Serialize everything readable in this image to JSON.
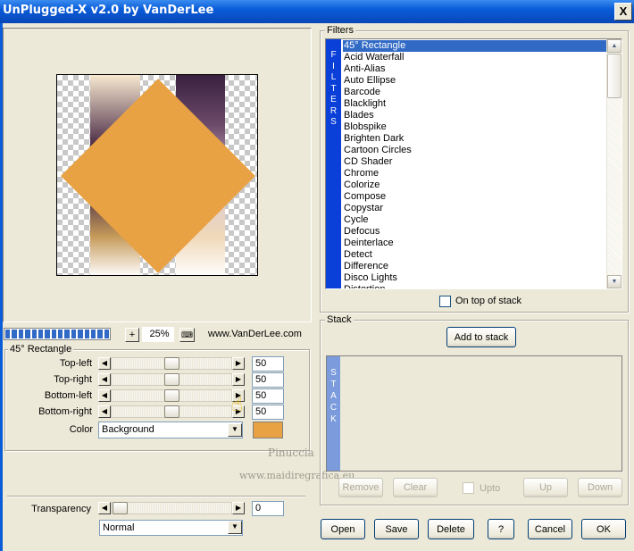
{
  "window": {
    "title": "UnPlugged-X v2.0 by VanDerLee",
    "close_label": "X"
  },
  "preview": {
    "zoom_out_label": "+",
    "zoom": "25%",
    "url": "www.VanDerLee.com",
    "progress_segments": 16
  },
  "params": {
    "group_title": "45° Rectangle",
    "sliders": [
      {
        "label": "Top-left",
        "value": "50"
      },
      {
        "label": "Top-right",
        "value": "50"
      },
      {
        "label": "Bottom-left",
        "value": "50"
      },
      {
        "label": "Bottom-right",
        "value": "50"
      }
    ],
    "color_label": "Color",
    "color_value": "Background",
    "color_swatch": "#e8a244"
  },
  "transparency": {
    "label": "Transparency",
    "value": "0",
    "blend_mode": "Normal"
  },
  "filters": {
    "group_title": "Filters",
    "side_label": [
      "F",
      "I",
      "L",
      "T",
      "E",
      "R",
      "S"
    ],
    "items": [
      "45° Rectangle",
      "Acid Waterfall",
      "Anti-Alias",
      "Auto Ellipse",
      "Barcode",
      "Blacklight",
      "Blades",
      "Blobspike",
      "Brighten Dark",
      "Cartoon Circles",
      "CD Shader",
      "Chrome",
      "Colorize",
      "Compose",
      "Copystar",
      "Cycle",
      "Defocus",
      "Deinterlace",
      "Detect",
      "Difference",
      "Disco Lights",
      "Distortion"
    ],
    "selected": "45° Rectangle",
    "on_top_label": "On top of stack"
  },
  "stack": {
    "group_title": "Stack",
    "add_label": "Add to stack",
    "side_label": [
      "S",
      "T",
      "A",
      "C",
      "K"
    ],
    "remove_label": "Remove",
    "clear_label": "Clear",
    "upto_label": "Upto",
    "up_label": "Up",
    "down_label": "Down"
  },
  "footer": {
    "open": "Open",
    "save": "Save",
    "delete": "Delete",
    "help": "?",
    "cancel": "Cancel",
    "ok": "OK"
  },
  "watermark": {
    "line1": "Pinuccia",
    "line2": "www.maidiregrafica.eu"
  },
  "colors": {
    "accent": "#316ac5",
    "filter_bar": "#0a3fd8",
    "stack_bar": "#7b9bdc",
    "face": "#ece9d8"
  }
}
